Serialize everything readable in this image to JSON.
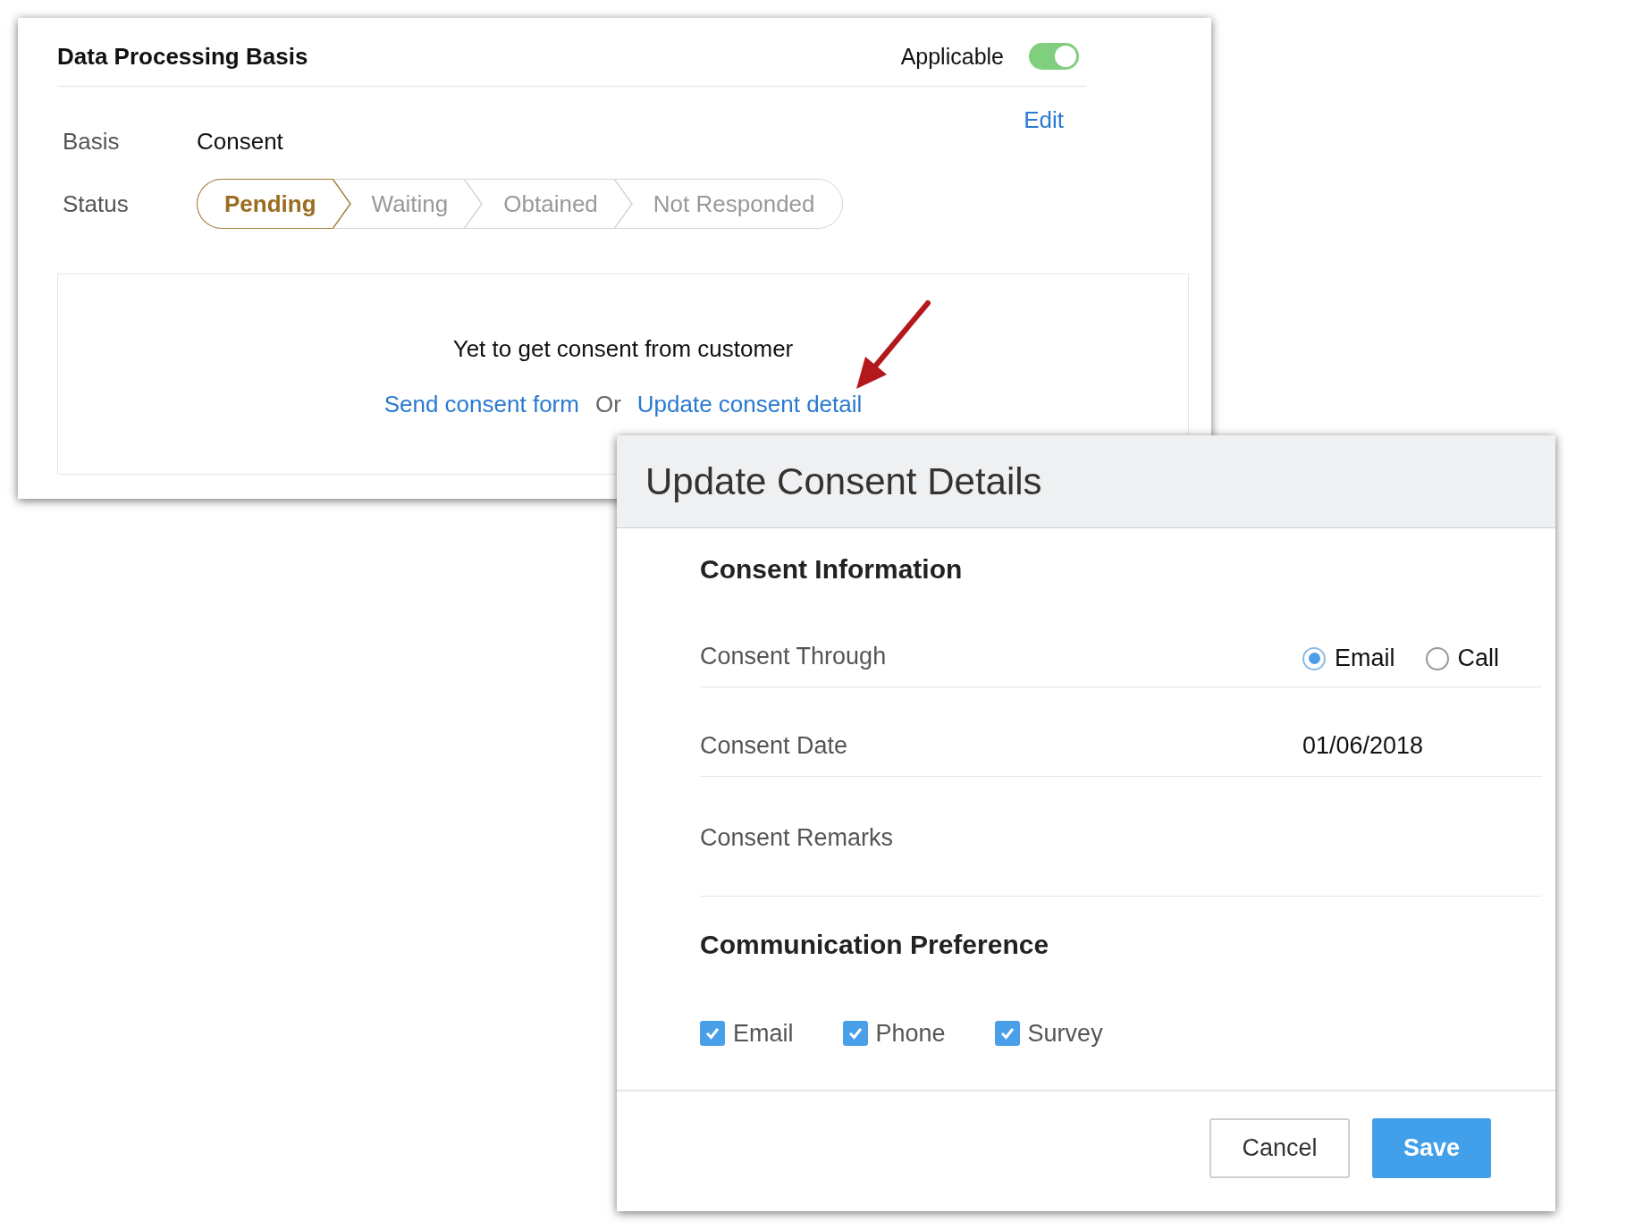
{
  "panel": {
    "title": "Data Processing Basis",
    "applicable": {
      "label": "Applicable",
      "on": true
    },
    "edit_link": "Edit",
    "fields": [
      {
        "label": "Basis",
        "value": "Consent"
      }
    ],
    "status": {
      "label": "Status",
      "steps": [
        {
          "label": "Pending",
          "selected": true
        },
        {
          "label": "Waiting",
          "selected": false
        },
        {
          "label": "Obtained",
          "selected": false
        },
        {
          "label": "Not Responded",
          "selected": false
        }
      ]
    },
    "message": "Yet to get consent from customer",
    "actions": [
      {
        "kind": "link",
        "text": "Send consent form"
      },
      {
        "kind": "text",
        "text": "Or"
      },
      {
        "kind": "link",
        "text": "Update consent detail"
      }
    ]
  },
  "dialog": {
    "title": "Update Consent Details",
    "consent_information": {
      "heading": "Consent Information",
      "consent_through": {
        "label": "Consent Through",
        "options": [
          {
            "label": "Email",
            "selected": true
          },
          {
            "label": "Call",
            "selected": false
          }
        ]
      },
      "consent_date": {
        "label": "Consent Date",
        "value": "01/06/2018"
      },
      "consent_remarks": {
        "label": "Consent Remarks"
      }
    },
    "communication_preference": {
      "heading": "Communication Preference",
      "options": [
        {
          "label": "Email",
          "checked": true
        },
        {
          "label": "Phone",
          "checked": true
        },
        {
          "label": "Survey",
          "checked": true
        }
      ]
    },
    "buttons": [
      {
        "kind": "secondary",
        "label": "Cancel"
      },
      {
        "kind": "primary",
        "label": "Save"
      }
    ]
  }
}
